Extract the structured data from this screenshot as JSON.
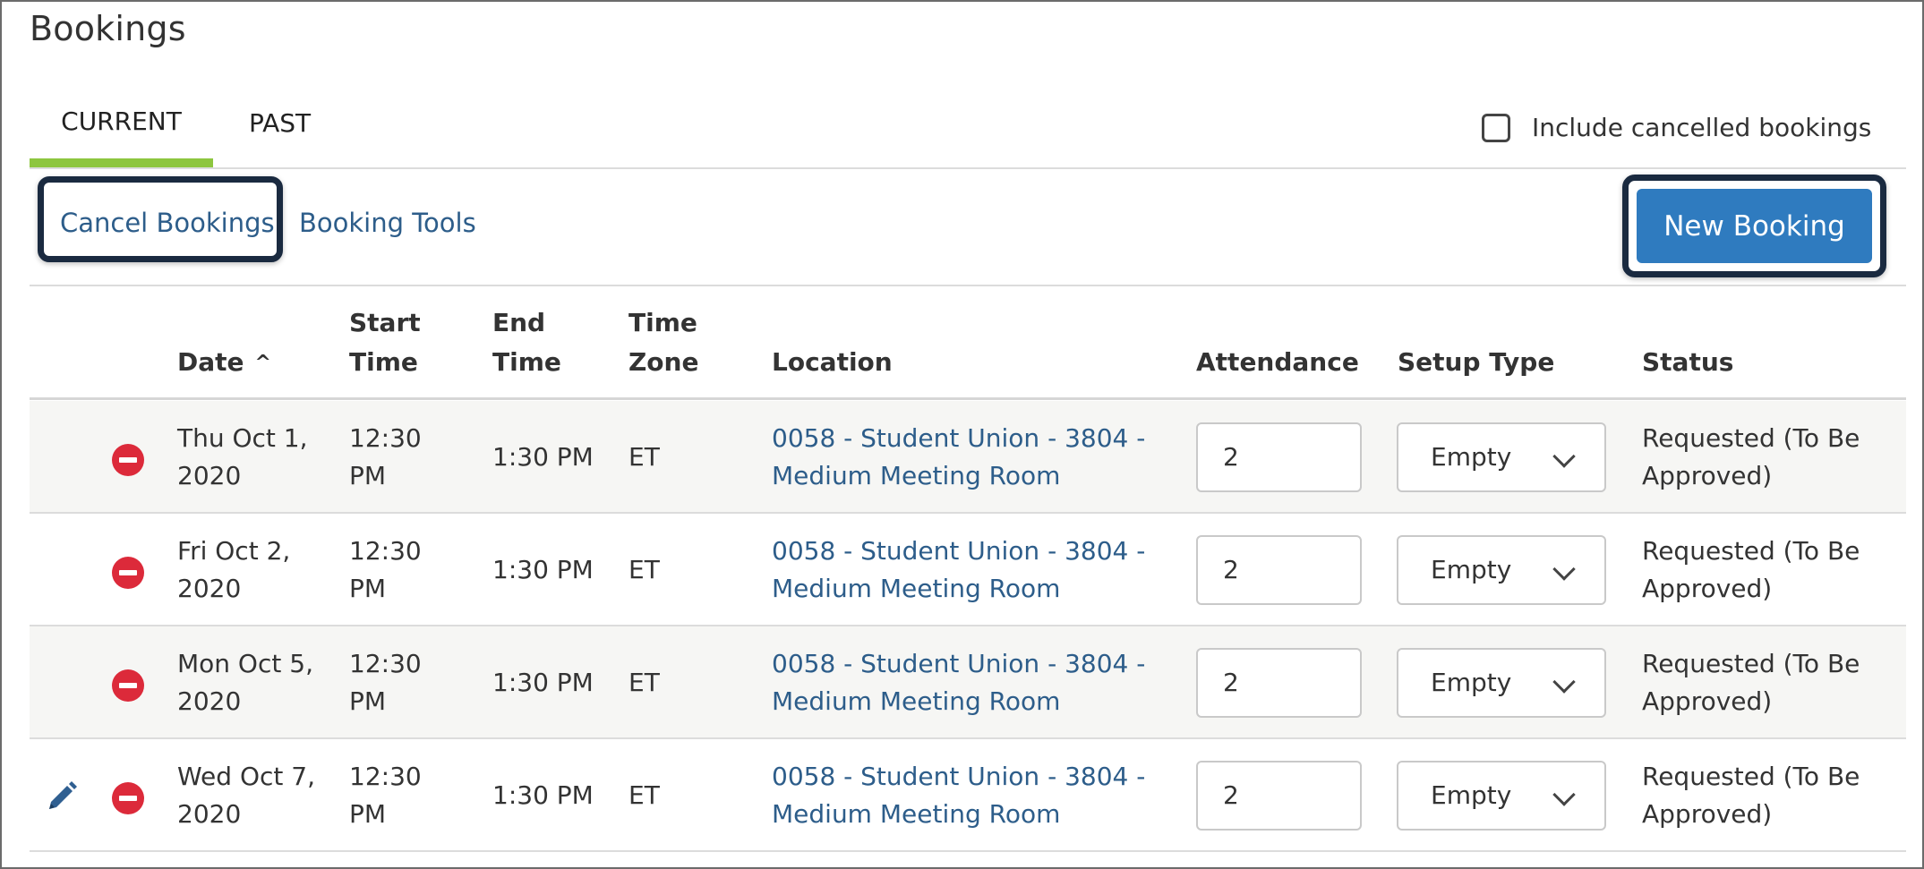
{
  "page": {
    "title": "Bookings"
  },
  "tabs": {
    "current": "CURRENT",
    "past": "PAST"
  },
  "filters": {
    "include_cancelled": "Include cancelled bookings"
  },
  "actions": {
    "cancel": "Cancel Bookings",
    "tools": "Booking Tools",
    "new": "New Booking"
  },
  "columns": {
    "date": "Date",
    "start_1": "Start",
    "start_2": "Time",
    "end_1": "End",
    "end_2": "Time",
    "tz_1": "Time",
    "tz_2": "Zone",
    "location": "Location",
    "attendance": "Attendance",
    "setup": "Setup Type",
    "status": "Status"
  },
  "sort_caret": "^",
  "rows": [
    {
      "date_1": "Thu Oct 1,",
      "date_2": "2020",
      "start_1": "12:30",
      "start_2": "PM",
      "end": "1:30 PM",
      "tz": "ET",
      "loc_1": "0058 - Student Union - 3804 -",
      "loc_2": "Medium Meeting Room",
      "attendance": "2",
      "setup": "Empty",
      "status_1": "Requested (To Be",
      "status_2": "Approved)",
      "editable": false
    },
    {
      "date_1": "Fri Oct 2,",
      "date_2": "2020",
      "start_1": "12:30",
      "start_2": "PM",
      "end": "1:30 PM",
      "tz": "ET",
      "loc_1": "0058 - Student Union - 3804 -",
      "loc_2": "Medium Meeting Room",
      "attendance": "2",
      "setup": "Empty",
      "status_1": "Requested (To Be",
      "status_2": "Approved)",
      "editable": false
    },
    {
      "date_1": "Mon Oct 5,",
      "date_2": "2020",
      "start_1": "12:30",
      "start_2": "PM",
      "end": "1:30 PM",
      "tz": "ET",
      "loc_1": "0058 - Student Union - 3804 -",
      "loc_2": "Medium Meeting Room",
      "attendance": "2",
      "setup": "Empty",
      "status_1": "Requested (To Be",
      "status_2": "Approved)",
      "editable": false
    },
    {
      "date_1": "Wed Oct 7,",
      "date_2": "2020",
      "start_1": "12:30",
      "start_2": "PM",
      "end": "1:30 PM",
      "tz": "ET",
      "loc_1": "0058 - Student Union - 3804 -",
      "loc_2": "Medium Meeting Room",
      "attendance": "2",
      "setup": "Empty",
      "status_1": "Requested (To Be",
      "status_2": "Approved)",
      "editable": true
    }
  ],
  "icons": {
    "remove": "remove-circle-icon",
    "edit": "pencil-icon",
    "checkbox": "checkbox-empty-icon",
    "chevron": "chevron-down-icon"
  },
  "colors": {
    "tab_accent": "#8dc63f",
    "link": "#2d5d8a",
    "primary": "#2f7bbf",
    "remove": "#dc2a3a",
    "highlight_border": "#1a2a40"
  }
}
